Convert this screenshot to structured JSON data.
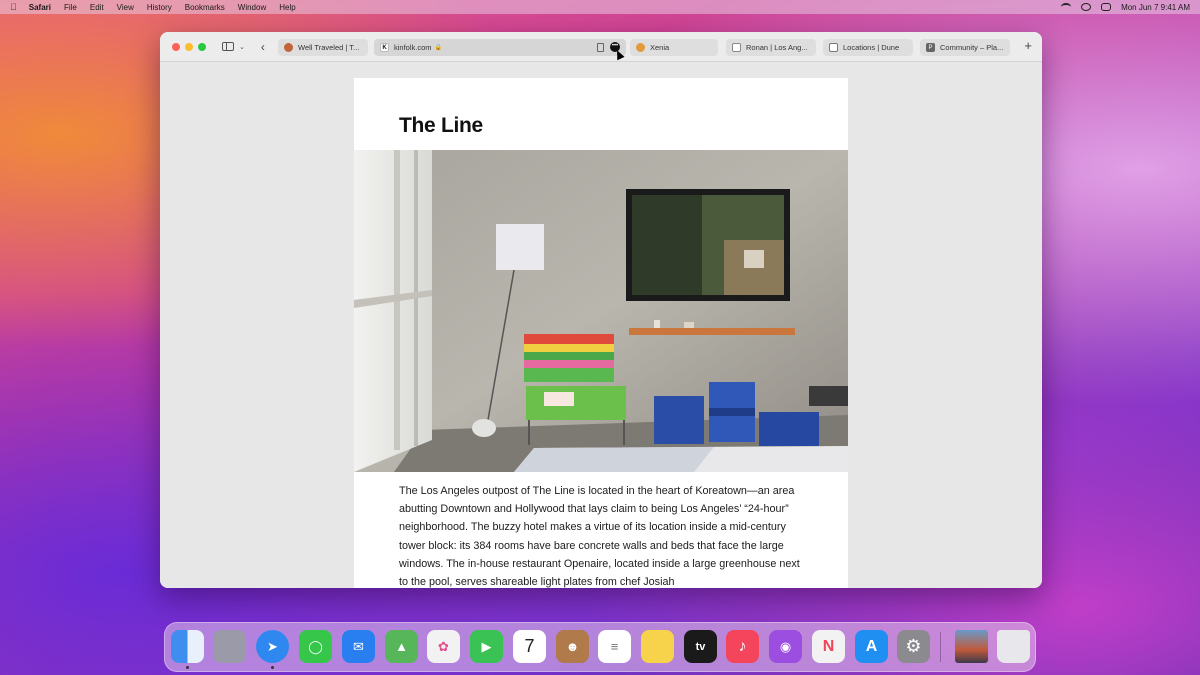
{
  "menubar": {
    "app_name": "Safari",
    "items": [
      "File",
      "Edit",
      "View",
      "History",
      "Bookmarks",
      "Window",
      "Help"
    ],
    "clock": "Mon Jun 7  9:41 AM"
  },
  "tabs": [
    {
      "label": "Well Traveled | T...",
      "favicon_color": "#c2643a",
      "favicon_char": ""
    },
    {
      "label": "kinfolk.com",
      "favicon_color": "#ffffff",
      "favicon_char": "K",
      "active": true
    },
    {
      "label": "Xenia",
      "favicon_color": "#e39a3a",
      "favicon_char": ""
    },
    {
      "label": "Ronan | Los Ang...",
      "favicon_color": "#888888",
      "favicon_char": ""
    },
    {
      "label": "Locations | Dune",
      "favicon_color": "#777777",
      "favicon_char": ""
    },
    {
      "label": "Community – Pla...",
      "favicon_color": "#666666",
      "favicon_char": "P"
    }
  ],
  "article": {
    "title": "The Line",
    "body": "The Los Angeles outpost of The Line is located in the heart of Koreatown—an area abutting Downtown and Hollywood that lays claim to being Los Angeles’ “24-hour” neighborhood. The buzzy hotel makes a virtue of its location inside a mid-century tower block: its 384 rooms have bare concrete walls and beds that face the large windows. The in-house restaurant Openaire, located inside a large greenhouse next to the pool, serves shareable light plates from chef Josiah"
  },
  "dock": {
    "apps": [
      {
        "name": "finder-icon",
        "color": "#3e8ef0",
        "label": "",
        "running": true
      },
      {
        "name": "launchpad-icon",
        "color": "#9a9aa8",
        "label": "",
        "running": false
      },
      {
        "name": "safari-icon",
        "color": "#2f88f0",
        "label": "",
        "running": true
      },
      {
        "name": "messages-icon",
        "color": "#35c64a",
        "label": "",
        "running": false
      },
      {
        "name": "mail-icon",
        "color": "#2a7ff0",
        "label": "",
        "running": false
      },
      {
        "name": "maps-icon",
        "color": "#58b65a",
        "label": "",
        "running": false
      },
      {
        "name": "photos-icon",
        "color": "#f2f2f2",
        "label": "",
        "running": false
      },
      {
        "name": "facetime-icon",
        "color": "#3ac354",
        "label": "",
        "running": false
      },
      {
        "name": "calendar-icon",
        "color": "#ffffff",
        "label": "7",
        "running": false
      },
      {
        "name": "contacts-icon",
        "color": "#b07a4a",
        "label": "",
        "running": false
      },
      {
        "name": "reminders-icon",
        "color": "#ffffff",
        "label": "",
        "running": false
      },
      {
        "name": "notes-icon",
        "color": "#f6d34a",
        "label": "",
        "running": false
      },
      {
        "name": "apple-tv-icon",
        "color": "#1a1a1a",
        "label": "tv",
        "running": false
      },
      {
        "name": "music-icon",
        "color": "#f5455c",
        "label": "♪",
        "running": false
      },
      {
        "name": "podcasts-icon",
        "color": "#9c4ee0",
        "label": "",
        "running": false
      },
      {
        "name": "news-icon",
        "color": "#f2f2f2",
        "label": "",
        "running": false
      },
      {
        "name": "app-store-icon",
        "color": "#1f8ff2",
        "label": "A",
        "running": false
      },
      {
        "name": "system-preferences-icon",
        "color": "#8a8a8f",
        "label": "⚙",
        "running": false
      },
      {
        "name": "photo-stack-icon",
        "color": "#4a6a8a",
        "label": "",
        "running": false
      },
      {
        "name": "trash-icon",
        "color": "#e8e8ec",
        "label": "",
        "running": false
      }
    ]
  }
}
